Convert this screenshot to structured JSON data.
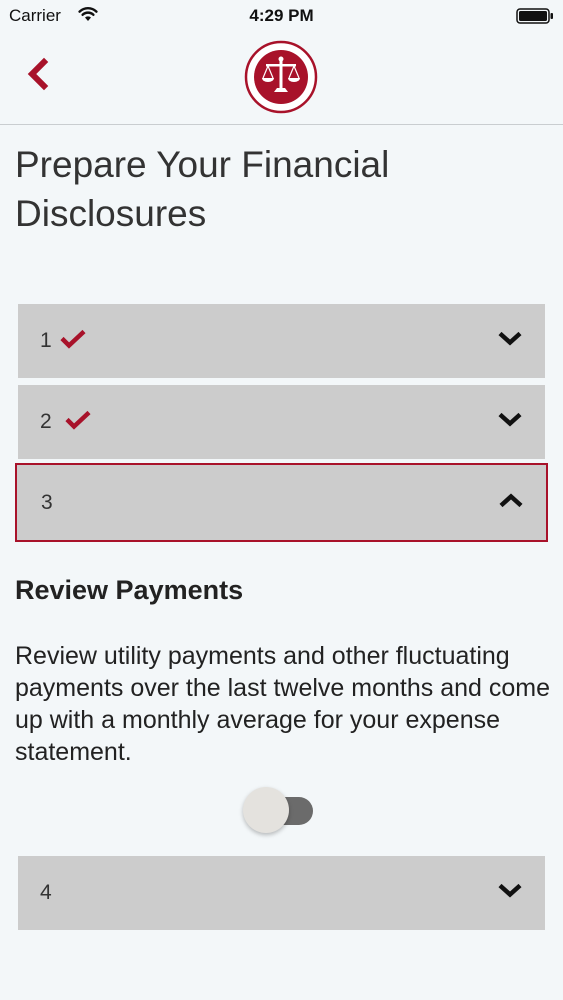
{
  "status_bar": {
    "carrier": "Carrier",
    "time": "4:29 PM"
  },
  "nav": {
    "back_icon": "chevron-left-icon",
    "logo_icon": "scales-of-justice-icon"
  },
  "page": {
    "title": "Prepare Your Financial Disclosures"
  },
  "steps": [
    {
      "number": "1",
      "completed": true,
      "expanded": false
    },
    {
      "number": "2",
      "completed": true,
      "expanded": false
    },
    {
      "number": "3",
      "completed": false,
      "expanded": true
    },
    {
      "number": "4",
      "completed": false,
      "expanded": false
    }
  ],
  "expanded_step": {
    "heading": "Review Payments",
    "body": "Review utility payments and other fluctuating payments over the last twelve months and come up with a monthly average for your expense statement.",
    "toggle_on": false
  },
  "colors": {
    "accent": "#a8122a",
    "background": "#f3f7f9",
    "step_background": "#cccccc"
  }
}
